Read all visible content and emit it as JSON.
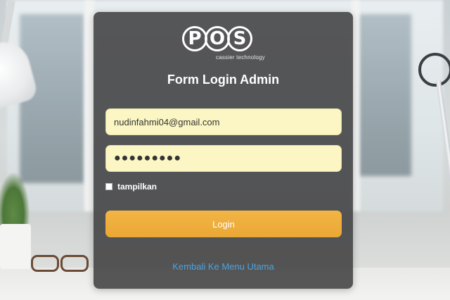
{
  "logo": {
    "letters": [
      "P",
      "O",
      "S"
    ],
    "tagline": "cassier technology"
  },
  "form": {
    "title": "Form Login Admin",
    "email_value": "nudinfahmi04@gmail.com",
    "password_display": "●●●●●●●●●",
    "show_password_label": "tampilkan",
    "show_password_checked": false,
    "login_label": "Login",
    "back_link_label": "Kembali Ke Menu Utama"
  },
  "colors": {
    "panel_bg": "#3c3c3e",
    "field_bg": "#fbf6c3",
    "button": "#f0b040",
    "link": "#4aa3df"
  }
}
